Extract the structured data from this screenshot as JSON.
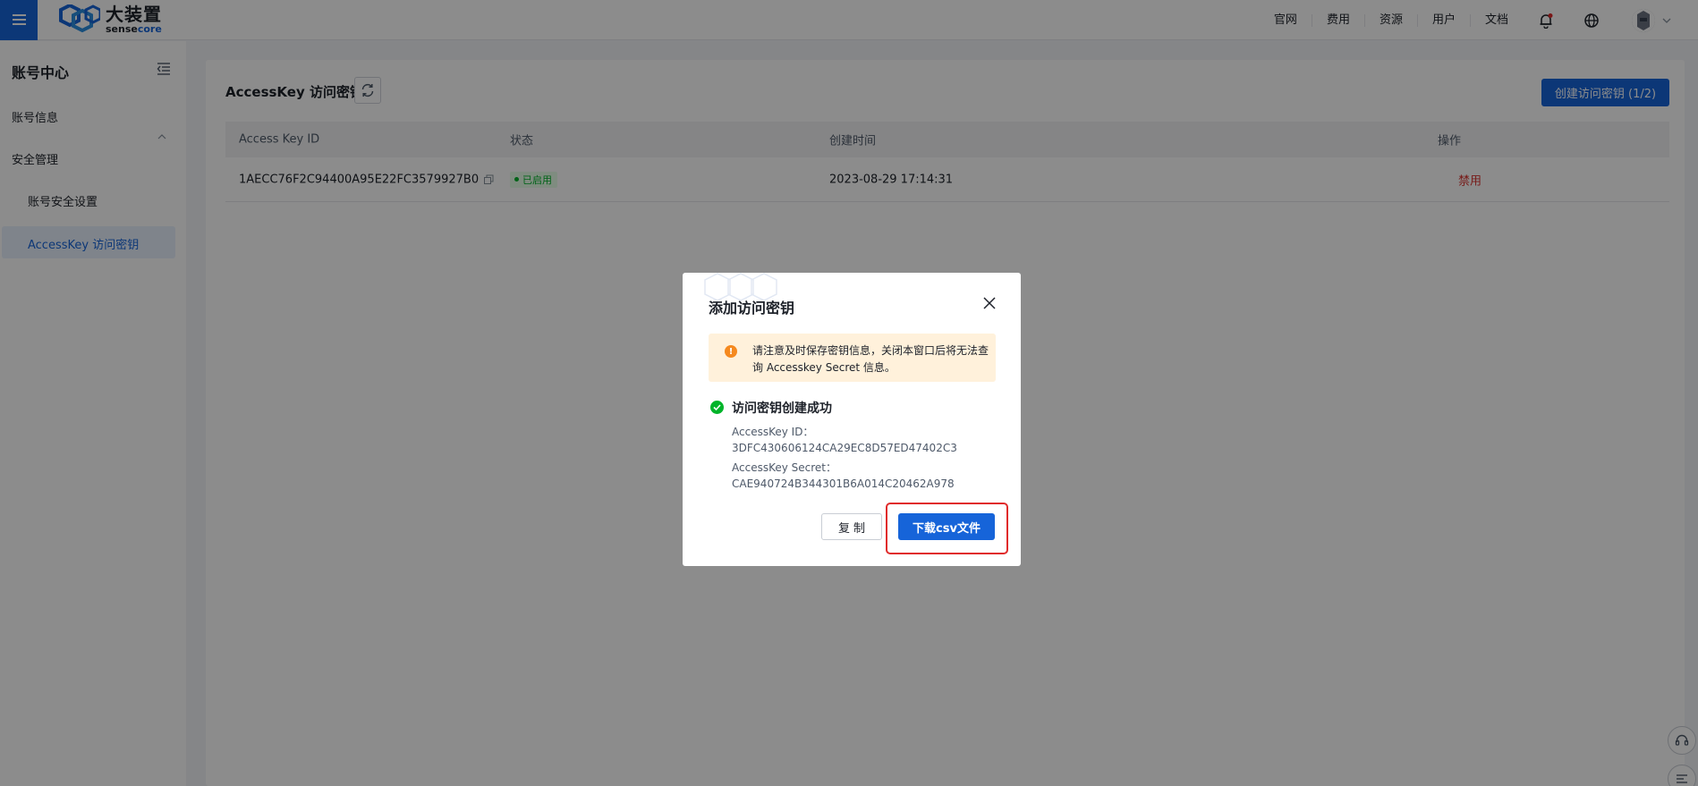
{
  "header": {
    "logo_cn": "大装置",
    "logo_en_a": "sense",
    "logo_en_b": "core",
    "nav": [
      "官网",
      "费用",
      "资源",
      "用户",
      "文档"
    ],
    "icons": [
      "bell-icon",
      "globe-icon",
      "avatar"
    ],
    "accent": "#1664d9"
  },
  "sidebar": {
    "title": "账号中心",
    "items": [
      {
        "label": "账号信息"
      },
      {
        "label": "安全管理"
      },
      {
        "label": "账号安全设置"
      },
      {
        "label": "AccessKey 访问密钥"
      }
    ]
  },
  "main": {
    "title": "AccessKey 访问密钥",
    "create_button": "创建访问密钥 (1/2)",
    "table": {
      "headers": [
        "Access Key ID",
        "状态",
        "创建时间",
        "操作"
      ],
      "rows": [
        {
          "id": "1AECC76F2C94400A95E22FC3579927B0",
          "status": "已启用",
          "created": "2023-08-29 17:14:31",
          "action": "禁用"
        }
      ]
    }
  },
  "modal": {
    "title": "添加访问密钥",
    "warning": "请注意及时保存密钥信息，关闭本窗口后将无法查询 Accesskey Secret 信息。",
    "success": "访问密钥创建成功",
    "id_label": "AccessKey ID：",
    "id_value": "3DFC430606124CA29EC8D57ED47402C3",
    "secret_label": "AccessKey Secret：",
    "secret_value": "CAE940724B344301B6A014C20462A978",
    "copy_button": "复制",
    "download_button": "下载csv文件"
  }
}
